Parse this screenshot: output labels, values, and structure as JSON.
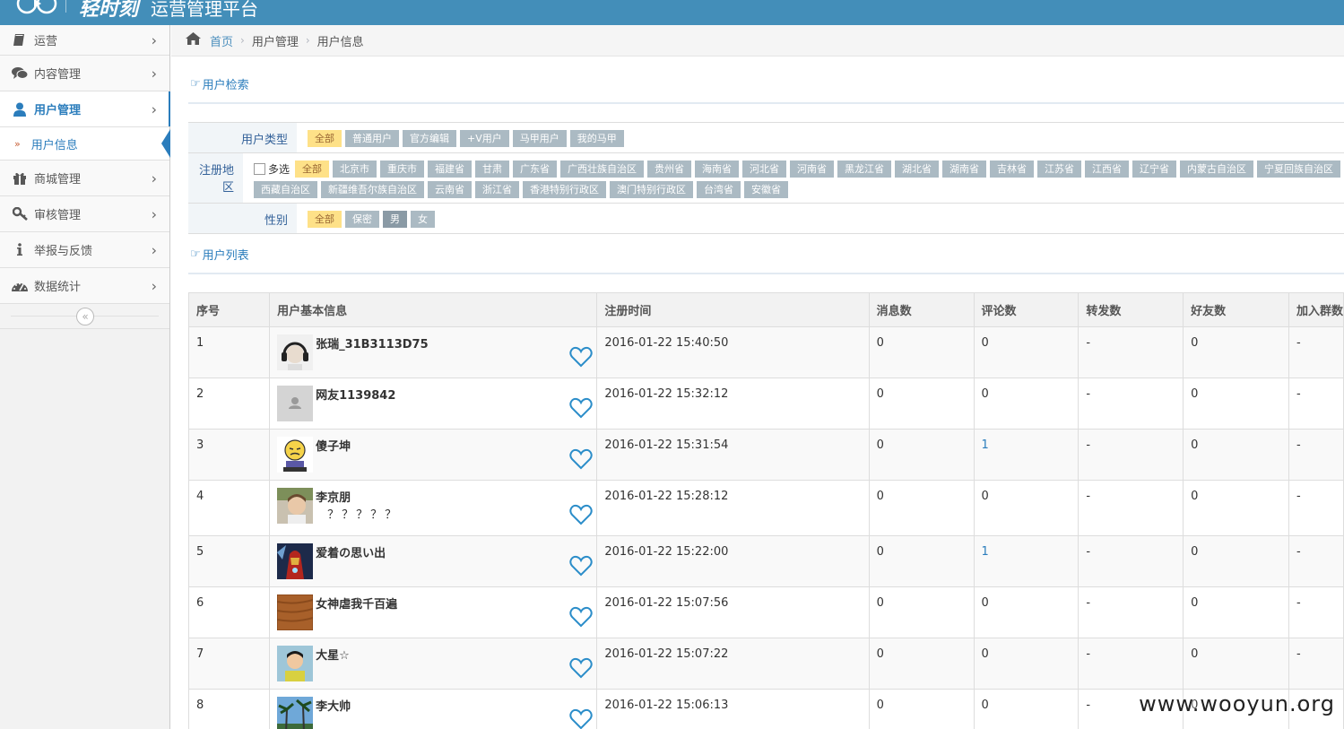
{
  "app": {
    "brand_logo": "轻时刻",
    "title": "运营管理平台"
  },
  "sidebar": {
    "items": [
      {
        "label": "运营",
        "icon": "book-icon"
      },
      {
        "label": "内容管理",
        "icon": "comments-icon"
      },
      {
        "label": "用户管理",
        "icon": "user-icon",
        "active": true
      },
      {
        "label": "商城管理",
        "icon": "gift-icon"
      },
      {
        "label": "审核管理",
        "icon": "key-icon"
      },
      {
        "label": "举报与反馈",
        "icon": "info-icon"
      },
      {
        "label": "数据统计",
        "icon": "dashboard-icon"
      }
    ],
    "sub_item": "用户信息",
    "collapse_glyph": "«"
  },
  "breadcrumb": {
    "home": "首页",
    "level1": "用户管理",
    "level2": "用户信息"
  },
  "search_section": {
    "title": "用户检索"
  },
  "filters": {
    "user_type": {
      "label": "用户类型",
      "options": [
        "全部",
        "普通用户",
        "官方编辑",
        "+V用户",
        "马甲用户",
        "我的马甲"
      ],
      "selected": "全部"
    },
    "region": {
      "label": "注册地区",
      "multi_label": "多选",
      "options": [
        "全部",
        "北京市",
        "重庆市",
        "福建省",
        "甘肃",
        "广东省",
        "广西壮族自治区",
        "贵州省",
        "海南省",
        "河北省",
        "河南省",
        "黑龙江省",
        "湖北省",
        "湖南省",
        "吉林省",
        "江苏省",
        "江西省",
        "辽宁省",
        "内蒙古自治区",
        "宁夏回族自治区",
        "西藏自治区",
        "新疆维吾尔族自治区",
        "云南省",
        "浙江省",
        "香港特别行政区",
        "澳门特别行政区",
        "台湾省",
        "安徽省"
      ],
      "selected": "全部"
    },
    "gender": {
      "label": "性别",
      "options": [
        "全部",
        "保密",
        "男",
        "女"
      ],
      "selected": "全部"
    }
  },
  "list_section": {
    "title": "用户列表"
  },
  "table": {
    "headers": [
      "序号",
      "用户基本信息",
      "注册时间",
      "消息数",
      "评论数",
      "转发数",
      "好友数",
      "加入群数"
    ],
    "rows": [
      {
        "no": "1",
        "name": "张瑞_31B3113D75",
        "sub": "",
        "time": "2016-01-22 15:40:50",
        "msg": "0",
        "comment": "0",
        "forward": "-",
        "friends": "0",
        "groups": "-",
        "avatar": "photo-headphones"
      },
      {
        "no": "2",
        "name": "网友1139842",
        "sub": "",
        "time": "2016-01-22 15:32:12",
        "msg": "0",
        "comment": "0",
        "forward": "-",
        "friends": "0",
        "groups": "-",
        "avatar": "default-user"
      },
      {
        "no": "3",
        "name": "傻子坤",
        "sub": "",
        "time": "2016-01-22 15:31:54",
        "msg": "0",
        "comment": "1",
        "forward": "-",
        "friends": "0",
        "groups": "-",
        "avatar": "cartoon-face"
      },
      {
        "no": "4",
        "name": "李京朋",
        "sub": "？？？？？",
        "time": "2016-01-22 15:28:12",
        "msg": "0",
        "comment": "0",
        "forward": "-",
        "friends": "0",
        "groups": "-",
        "avatar": "photo-child"
      },
      {
        "no": "5",
        "name": "爱着の思い出",
        "sub": "",
        "time": "2016-01-22 15:22:00",
        "msg": "0",
        "comment": "1",
        "forward": "-",
        "friends": "0",
        "groups": "-",
        "avatar": "photo-ironman"
      },
      {
        "no": "6",
        "name": "女神虐我千百遍",
        "sub": "",
        "time": "2016-01-22 15:07:56",
        "msg": "0",
        "comment": "0",
        "forward": "-",
        "friends": "0",
        "groups": "-",
        "avatar": "photo-wood"
      },
      {
        "no": "7",
        "name": "大星☆",
        "sub": "",
        "time": "2016-01-22 15:07:22",
        "msg": "0",
        "comment": "0",
        "forward": "-",
        "friends": "0",
        "groups": "-",
        "avatar": "photo-boy"
      },
      {
        "no": "8",
        "name": "李大帅",
        "sub": "",
        "time": "2016-01-22 15:06:13",
        "msg": "0",
        "comment": "0",
        "forward": "-",
        "friends": "0",
        "groups": "-",
        "avatar": "photo-palms"
      }
    ]
  },
  "watermark": "www.wooyun.org",
  "colors": {
    "topbar": "#438eb9",
    "accent": "#2b7dbc",
    "tag_default": "#abbac3",
    "tag_selected": "#fee188"
  }
}
